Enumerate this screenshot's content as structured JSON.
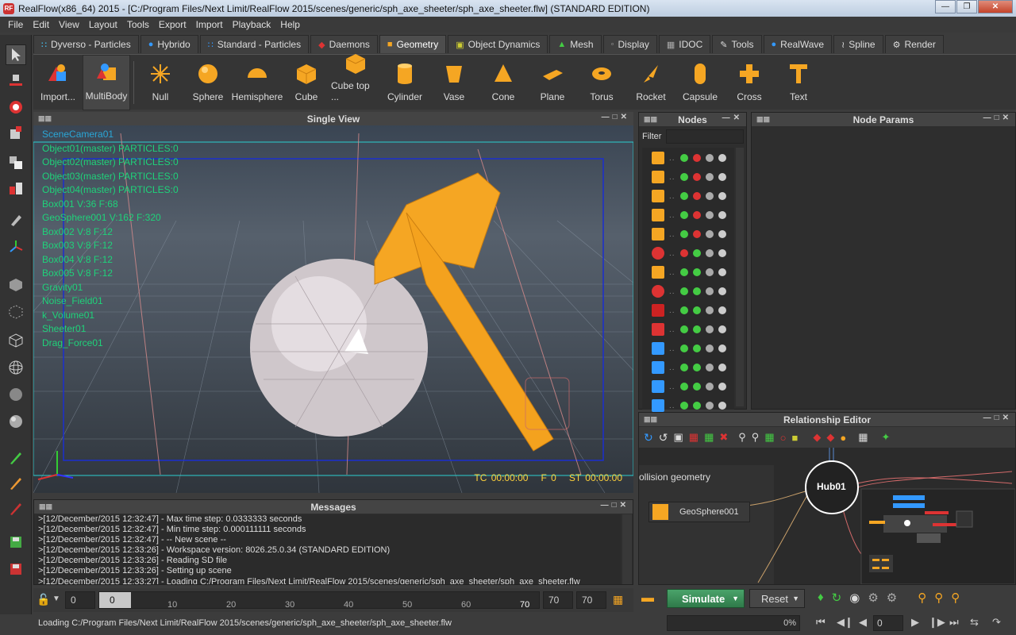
{
  "window": {
    "title": "RealFlow(x86_64) 2015 - [C:/Program Files/Next Limit/RealFlow 2015/scenes/generic/sph_axe_sheeter/sph_axe_sheeter.flw] (STANDARD EDITION)",
    "app_icon": "RF"
  },
  "menu": [
    "File",
    "Edit",
    "View",
    "Layout",
    "Tools",
    "Export",
    "Import",
    "Playback",
    "Help"
  ],
  "tabs": [
    {
      "label": "Dyverso - Particles",
      "icon": "particles-icon",
      "active": false
    },
    {
      "label": "Hybrido",
      "icon": "hybrido-icon",
      "active": false
    },
    {
      "label": "Standard - Particles",
      "icon": "particles-icon",
      "active": false
    },
    {
      "label": "Daemons",
      "icon": "daemon-icon",
      "active": false
    },
    {
      "label": "Geometry",
      "icon": "cube-icon",
      "active": true
    },
    {
      "label": "Object Dynamics",
      "icon": "dynamics-icon",
      "active": false
    },
    {
      "label": "Mesh",
      "icon": "mesh-icon",
      "active": false
    },
    {
      "label": "Display",
      "icon": "display-icon",
      "active": false
    },
    {
      "label": "IDOC",
      "icon": "idoc-icon",
      "active": false
    },
    {
      "label": "Tools",
      "icon": "tools-icon",
      "active": false
    },
    {
      "label": "RealWave",
      "icon": "wave-icon",
      "active": false
    },
    {
      "label": "Spline",
      "icon": "spline-icon",
      "active": false
    },
    {
      "label": "Render",
      "icon": "render-icon",
      "active": false
    }
  ],
  "shelf": [
    "Import...",
    "MultiBody",
    "Null",
    "Sphere",
    "Hemisphere",
    "Cube",
    "Cube top ...",
    "Cylinder",
    "Vase",
    "Cone",
    "Plane",
    "Torus",
    "Rocket",
    "Capsule",
    "Cross",
    "Text"
  ],
  "viewport": {
    "title": "Single View",
    "objects": [
      "SceneCamera01",
      "Object01(master) PARTICLES:0",
      "Object02(master) PARTICLES:0",
      "Object03(master) PARTICLES:0",
      "Object04(master) PARTICLES:0",
      "Box001 V:36 F:68",
      "GeoSphere001 V:162 F:320",
      "Box002 V:8 F:12",
      "Box003 V:8 F:12",
      "Box004 V:8 F:12",
      "Box005 V:8 F:12",
      "Gravity01",
      "Noise_Field01",
      "k_Volume01",
      "Sheeter01",
      "Drag_Force01"
    ],
    "tc": "TC 00:00:00",
    "frame": "F 0",
    "st": "ST 00:00:00"
  },
  "nodes": {
    "title": "Nodes",
    "filter_label": "Filter",
    "filter_value": ""
  },
  "node_params": {
    "title": "Node Params"
  },
  "relationship": {
    "title": "Relationship Editor",
    "group_label": "ollision geometry",
    "node_label": "GeoSphere001",
    "hub_label": "Hub01"
  },
  "messages": {
    "title": "Messages",
    "lines": [
      ">[12/December/2015 12:32:47] - Max time step: 0.0333333 seconds",
      ">[12/December/2015 12:32:47] - Min time step: 0.000111111 seconds",
      ">[12/December/2015 12:32:47] - -- New scene --",
      ">[12/December/2015 12:33:26] - Workspace version: 8026.25.0.34 (STANDARD EDITION)",
      ">[12/December/2015 12:33:26] - Reading SD file",
      ">[12/December/2015 12:33:26] - Setting up scene",
      ">[12/December/2015 12:33:27] -  Loading C:/Program Files/Next Limit/RealFlow 2015/scenes/generic/sph_axe_sheeter/sph_axe_sheeter.flw"
    ]
  },
  "timeline": {
    "start": "0",
    "current": "0",
    "ticks": [
      "10",
      "20",
      "30",
      "40",
      "50",
      "60",
      "70"
    ],
    "end1": "70",
    "end2": "70"
  },
  "simulate_label": "Simulate",
  "reset_label": "Reset",
  "status_text": "Loading C:/Program Files/Next Limit/RealFlow 2015/scenes/generic/sph_axe_sheeter/sph_axe_sheeter.flw",
  "progress_text": "0%",
  "frame_value": "0"
}
